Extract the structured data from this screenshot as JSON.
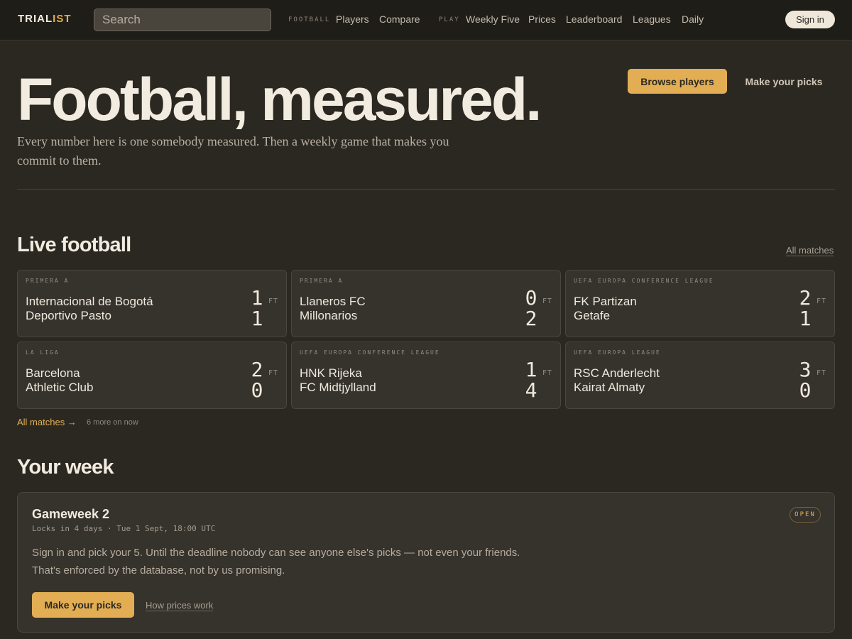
{
  "nav": {
    "logo_a": "TRIAL",
    "logo_b": "IST",
    "search_placeholder": "Search",
    "football_label": "FOOTBALL",
    "football_links": [
      "Players",
      "Compare"
    ],
    "play_label": "PLAY",
    "play_links": [
      "Weekly Five",
      "Prices",
      "Leaderboard",
      "Leagues",
      "Daily"
    ],
    "signin": "Sign in"
  },
  "hero": {
    "title": "Football, measured.",
    "subtitle": "Every number here is one somebody measured. Then a weekly game that makes you commit to them.",
    "browse": "Browse players",
    "picks": "Make your picks"
  },
  "live": {
    "title": "Live football",
    "all_matches_top": "All matches",
    "matches": [
      {
        "competition": "PRIMERA A",
        "home": "Internacional de Bogotá",
        "away": "Deportivo Pasto",
        "home_score": "1",
        "away_score": "1",
        "status": "FT"
      },
      {
        "competition": "PRIMERA A",
        "home": "Llaneros FC",
        "away": "Millonarios",
        "home_score": "0",
        "away_score": "2",
        "status": "FT"
      },
      {
        "competition": "UEFA EUROPA CONFERENCE LEAGUE",
        "home": "FK Partizan",
        "away": "Getafe",
        "home_score": "2",
        "away_score": "1",
        "status": "FT"
      },
      {
        "competition": "LA LIGA",
        "home": "Barcelona",
        "away": "Athletic Club",
        "home_score": "2",
        "away_score": "0",
        "status": "FT"
      },
      {
        "competition": "UEFA EUROPA CONFERENCE LEAGUE",
        "home": "HNK Rijeka",
        "away": "FC Midtjylland",
        "home_score": "1",
        "away_score": "4",
        "status": "FT"
      },
      {
        "competition": "UEFA EUROPA LEAGUE",
        "home": "RSC Anderlecht",
        "away": "Kairat Almaty",
        "home_score": "3",
        "away_score": "0",
        "status": "FT"
      }
    ],
    "all_matches_bottom": "All matches →",
    "more_now": "6 more on now"
  },
  "week": {
    "title": "Your week",
    "gameweek": "Gameweek 2",
    "locks": "Locks in 4 days · Tue 1 Sept, 18:00 UTC",
    "badge": "OPEN",
    "line1": "Sign in and pick your 5. Until the deadline nobody can see anyone else's picks — not even your friends.",
    "line2": "That's enforced by the database, not by us promising.",
    "picks_button": "Make your picks",
    "prices_link": "How prices work"
  },
  "colors": {
    "background": "#2b2822",
    "nav": "#1f1d18",
    "accent": "#e3ae53",
    "card": "#36322c"
  }
}
